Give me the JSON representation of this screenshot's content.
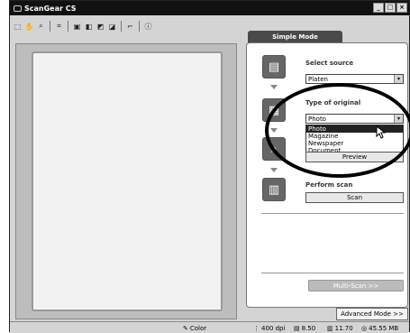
{
  "window": {
    "title": "ScanGear CS",
    "minimize_label": "_",
    "maximize_label": "□",
    "close_label": "×"
  },
  "toolbar": {
    "icons": [
      "select-area-icon",
      "zoom-icon",
      "magnify-icon",
      "crop-icon",
      "color-icon",
      "mirror-icon",
      "rotate-left-icon",
      "rotate-right-icon",
      "preferences-icon",
      "info-icon"
    ]
  },
  "panel": {
    "tab_label": "Simple Mode",
    "select_source_label": "Select source",
    "source_value": "Platen",
    "type_of_original_label": "Type of original",
    "type_value": "Photo",
    "type_options": [
      "Photo",
      "Magazine",
      "Newspaper",
      "Document"
    ],
    "preview_button": "Preview",
    "perform_scan_label": "Perform scan",
    "scan_button": "Scan",
    "multiscan_button": "Multi-Scan >>",
    "advanced_mode_button": "Advanced Mode >>"
  },
  "status": {
    "color_mode": "Color",
    "resolution": "400 dpi",
    "width": "8.50",
    "height": "11.70",
    "file_size": "45.55 MB"
  }
}
